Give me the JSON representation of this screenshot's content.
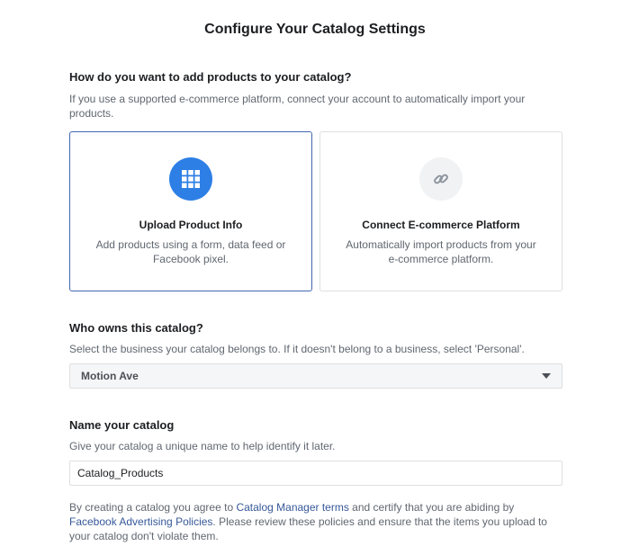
{
  "page": {
    "title": "Configure Your Catalog Settings"
  },
  "add_products": {
    "heading": "How do you want to add products to your catalog?",
    "description": "If you use a supported e-commerce platform, connect your account to automatically import your products.",
    "options": [
      {
        "title": "Upload Product Info",
        "description": "Add products using a form, data feed or Facebook pixel.",
        "icon": "grid-icon",
        "selected": true
      },
      {
        "title": "Connect E-commerce Platform",
        "description": "Automatically import products from your e-commerce platform.",
        "icon": "link-icon",
        "selected": false
      }
    ]
  },
  "owner": {
    "heading": "Who owns this catalog?",
    "description": "Select the business your catalog belongs to. If it doesn't belong to a business, select 'Personal'.",
    "selected_value": "Motion Ave"
  },
  "catalog_name": {
    "heading": "Name your catalog",
    "description": "Give your catalog a unique name to help identify it later.",
    "value": "Catalog_Products"
  },
  "legal": {
    "text_1": "By creating a catalog you agree to ",
    "link_1": "Catalog Manager terms",
    "text_2": " and certify that you are abiding by ",
    "link_2": "Facebook Advertising Policies",
    "text_3": ". Please review these policies and ensure that the items you upload to your catalog don't violate them."
  },
  "colors": {
    "accent": "#2d7fe6",
    "selected_border": "#4267b2",
    "link": "#365899"
  }
}
